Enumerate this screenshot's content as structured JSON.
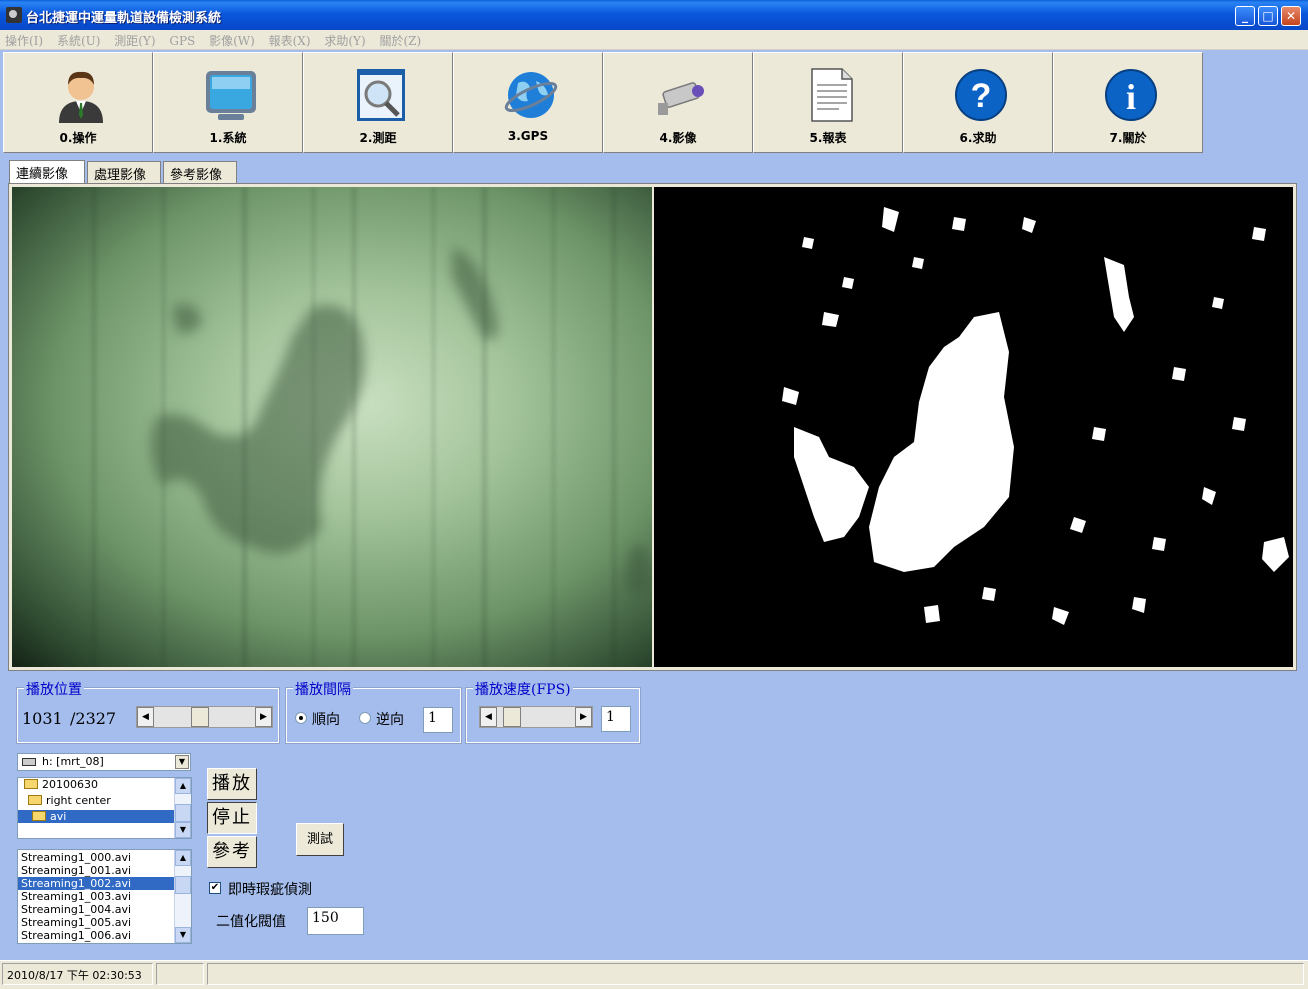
{
  "window": {
    "title": "台北捷運中運量軌道設備檢測系統",
    "minimize": "_",
    "maximize": "□",
    "close": "✕"
  },
  "menu": [
    "操作(I)",
    "系統(U)",
    "測距(Y)",
    "GPS",
    "影像(W)",
    "報表(X)",
    "求助(Y)",
    "關於(Z)"
  ],
  "toolbar": [
    {
      "label": "0.操作",
      "icon": "user-icon"
    },
    {
      "label": "1.系統",
      "icon": "monitor-icon"
    },
    {
      "label": "2.測距",
      "icon": "magnifier-icon"
    },
    {
      "label": "3.GPS",
      "icon": "globe-icon"
    },
    {
      "label": "4.影像",
      "icon": "camera-icon"
    },
    {
      "label": "5.報表",
      "icon": "document-icon"
    },
    {
      "label": "6.求助",
      "icon": "help-icon"
    },
    {
      "label": "7.關於",
      "icon": "info-icon"
    }
  ],
  "tabs": [
    "連續影像",
    "處理影像",
    "參考影像"
  ],
  "playback_position": {
    "title": "播放位置",
    "current": "1031",
    "total": "/2327",
    "slider_level": 0.44
  },
  "playback_interval": {
    "title": "播放間隔",
    "forward": "順向",
    "reverse": "逆向",
    "value": "1"
  },
  "playback_speed": {
    "title": "播放速度(FPS)",
    "value": "1",
    "slider_level": 0.1
  },
  "drive": "h: [mrt_08]",
  "folders": [
    {
      "name": "20100630",
      "selected": false
    },
    {
      "name": "right center",
      "selected": false
    },
    {
      "name": "avi",
      "selected": true
    }
  ],
  "files": [
    {
      "name": "Streaming1_000.avi",
      "selected": false
    },
    {
      "name": "Streaming1_001.avi",
      "selected": false
    },
    {
      "name": "Streaming1_002.avi",
      "selected": true
    },
    {
      "name": "Streaming1_003.avi",
      "selected": false
    },
    {
      "name": "Streaming1_004.avi",
      "selected": false
    },
    {
      "name": "Streaming1_005.avi",
      "selected": false
    },
    {
      "name": "Streaming1_006.avi",
      "selected": false
    }
  ],
  "buttons": {
    "play": "播放",
    "stop": "停止",
    "reference": "參考",
    "test": "測試"
  },
  "realtime_detection": {
    "label": "即時瑕疵偵測",
    "checked": true
  },
  "threshold": {
    "label": "二值化閥值",
    "value": "150"
  },
  "status": {
    "datetime": "2010/8/17 下午 02:30:53"
  }
}
